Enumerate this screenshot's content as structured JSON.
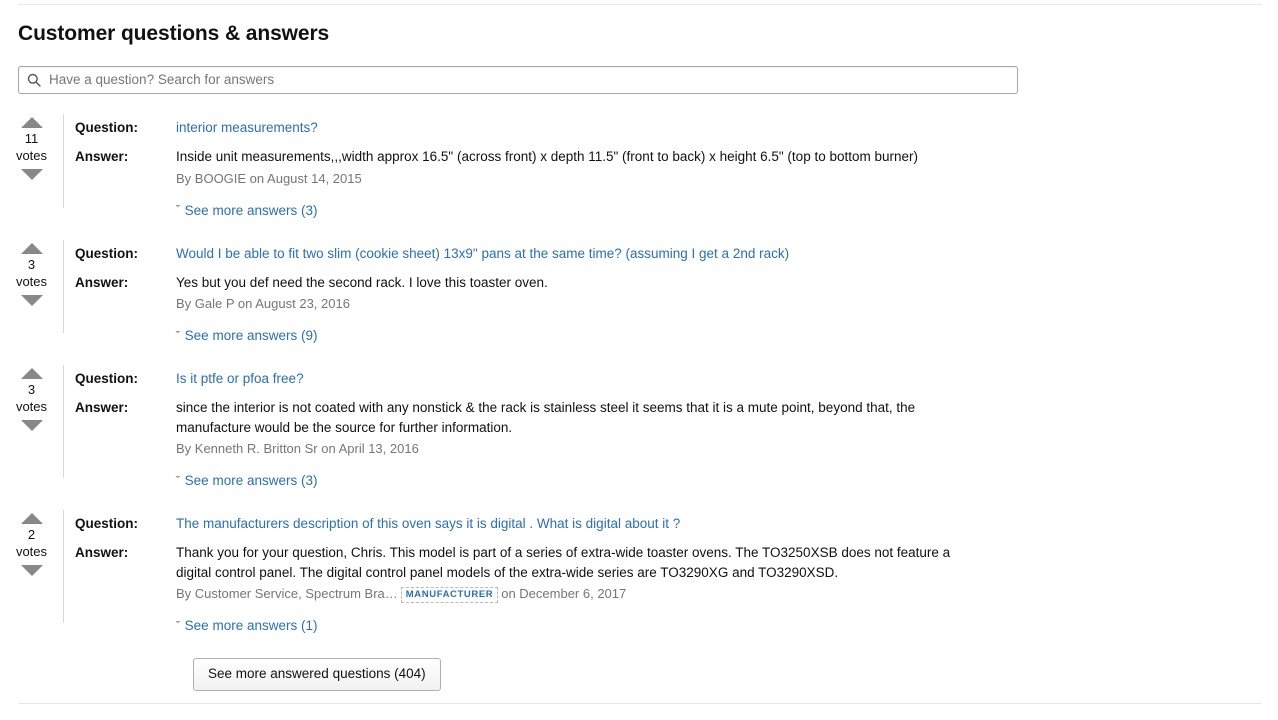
{
  "page": {
    "title": "Customer questions & answers"
  },
  "search": {
    "placeholder": "Have a question? Search for answers",
    "value": "",
    "icon": "search-icon"
  },
  "labels": {
    "question": "Question:",
    "answer": "Answer:",
    "votes": "votes",
    "chevron": "ˇ"
  },
  "qa": [
    {
      "votes": "11",
      "question": "interior measurements?",
      "answer": "Inside unit measurements,,,width approx 16.5\" (across front) x depth 11.5\" (front to back) x height 6.5\" (top to bottom burner)",
      "byline_prefix": "By BOOGIE on August 14, 2015",
      "badge": "",
      "byline_suffix": "",
      "see_more": "See more answers (3)"
    },
    {
      "votes": "3",
      "question": "Would I be able to fit two slim (cookie sheet) 13x9\" pans at the same time? (assuming I get a 2nd rack)",
      "answer": "Yes but you def need the second rack. I love this toaster oven.",
      "byline_prefix": "By Gale P on August 23, 2016",
      "badge": "",
      "byline_suffix": "",
      "see_more": "See more answers (9)"
    },
    {
      "votes": "3",
      "question": "Is it ptfe or pfoa free?",
      "answer": "since the interior is not coated with any nonstick & the rack is stainless steel it seems that it is a mute point, beyond that, the manufacture would be the source for further information.",
      "byline_prefix": "By Kenneth R. Britton Sr on April 13, 2016",
      "badge": "",
      "byline_suffix": "",
      "see_more": "See more answers (3)"
    },
    {
      "votes": "2",
      "question": "The manufacturers description of this oven says it is digital . What is digital about it ?",
      "answer": "Thank you for your question, Chris. This model is part of a series of extra-wide toaster ovens. The TO3250XSB does not feature a digital control panel. The digital control panel models of the extra-wide series are TO3290XG and TO3290XSD.",
      "byline_prefix": "By Customer Service, Spectrum Bra…",
      "badge": "MANUFACTURER",
      "byline_suffix": "on December 6, 2017",
      "see_more": "See more answers (1)"
    }
  ],
  "footer": {
    "more_questions_label": "See more answered questions (404)"
  },
  "colors": {
    "link": "#2b6fb5",
    "text": "#111111",
    "muted": "#767676",
    "arrow": "#888888",
    "rule": "#e7e7e7"
  }
}
